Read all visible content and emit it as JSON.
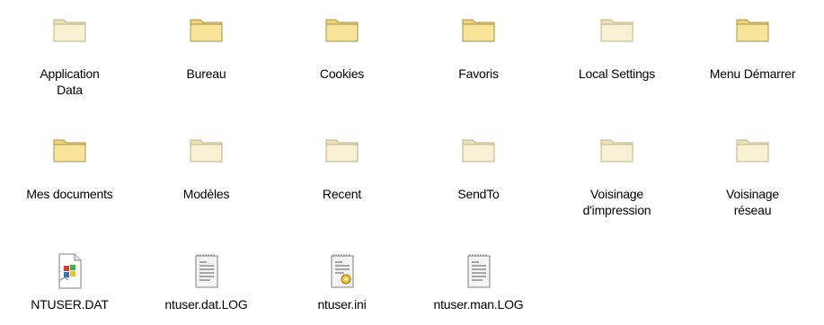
{
  "items": [
    {
      "label": "Application\nData",
      "icon": "folder-pale-icon"
    },
    {
      "label": "Bureau",
      "icon": "folder-icon"
    },
    {
      "label": "Cookies",
      "icon": "folder-icon"
    },
    {
      "label": "Favoris",
      "icon": "folder-icon"
    },
    {
      "label": "Local Settings",
      "icon": "folder-pale-icon"
    },
    {
      "label": "Menu Démarrer",
      "icon": "folder-icon"
    },
    {
      "label": "Mes documents",
      "icon": "folder-icon"
    },
    {
      "label": "Modèles",
      "icon": "folder-pale-icon"
    },
    {
      "label": "Recent",
      "icon": "folder-pale-icon"
    },
    {
      "label": "SendTo",
      "icon": "folder-pale-icon"
    },
    {
      "label": "Voisinage\nd'impression",
      "icon": "folder-pale-icon"
    },
    {
      "label": "Voisinage\nréseau",
      "icon": "folder-pale-icon"
    },
    {
      "label": "NTUSER.DAT",
      "icon": "system-file-icon"
    },
    {
      "label": "ntuser.dat.LOG",
      "icon": "text-file-icon"
    },
    {
      "label": "ntuser.ini",
      "icon": "settings-file-icon"
    },
    {
      "label": "ntuser.man.LOG",
      "icon": "text-file-icon"
    }
  ],
  "colors": {
    "folder_front": "#f9e59a",
    "folder_back": "#efd57a",
    "folder_outline": "#a4924a",
    "folder_pale_front": "#f7f0d2",
    "folder_pale_back": "#ede2b6",
    "folder_pale_outline": "#bdb089"
  }
}
